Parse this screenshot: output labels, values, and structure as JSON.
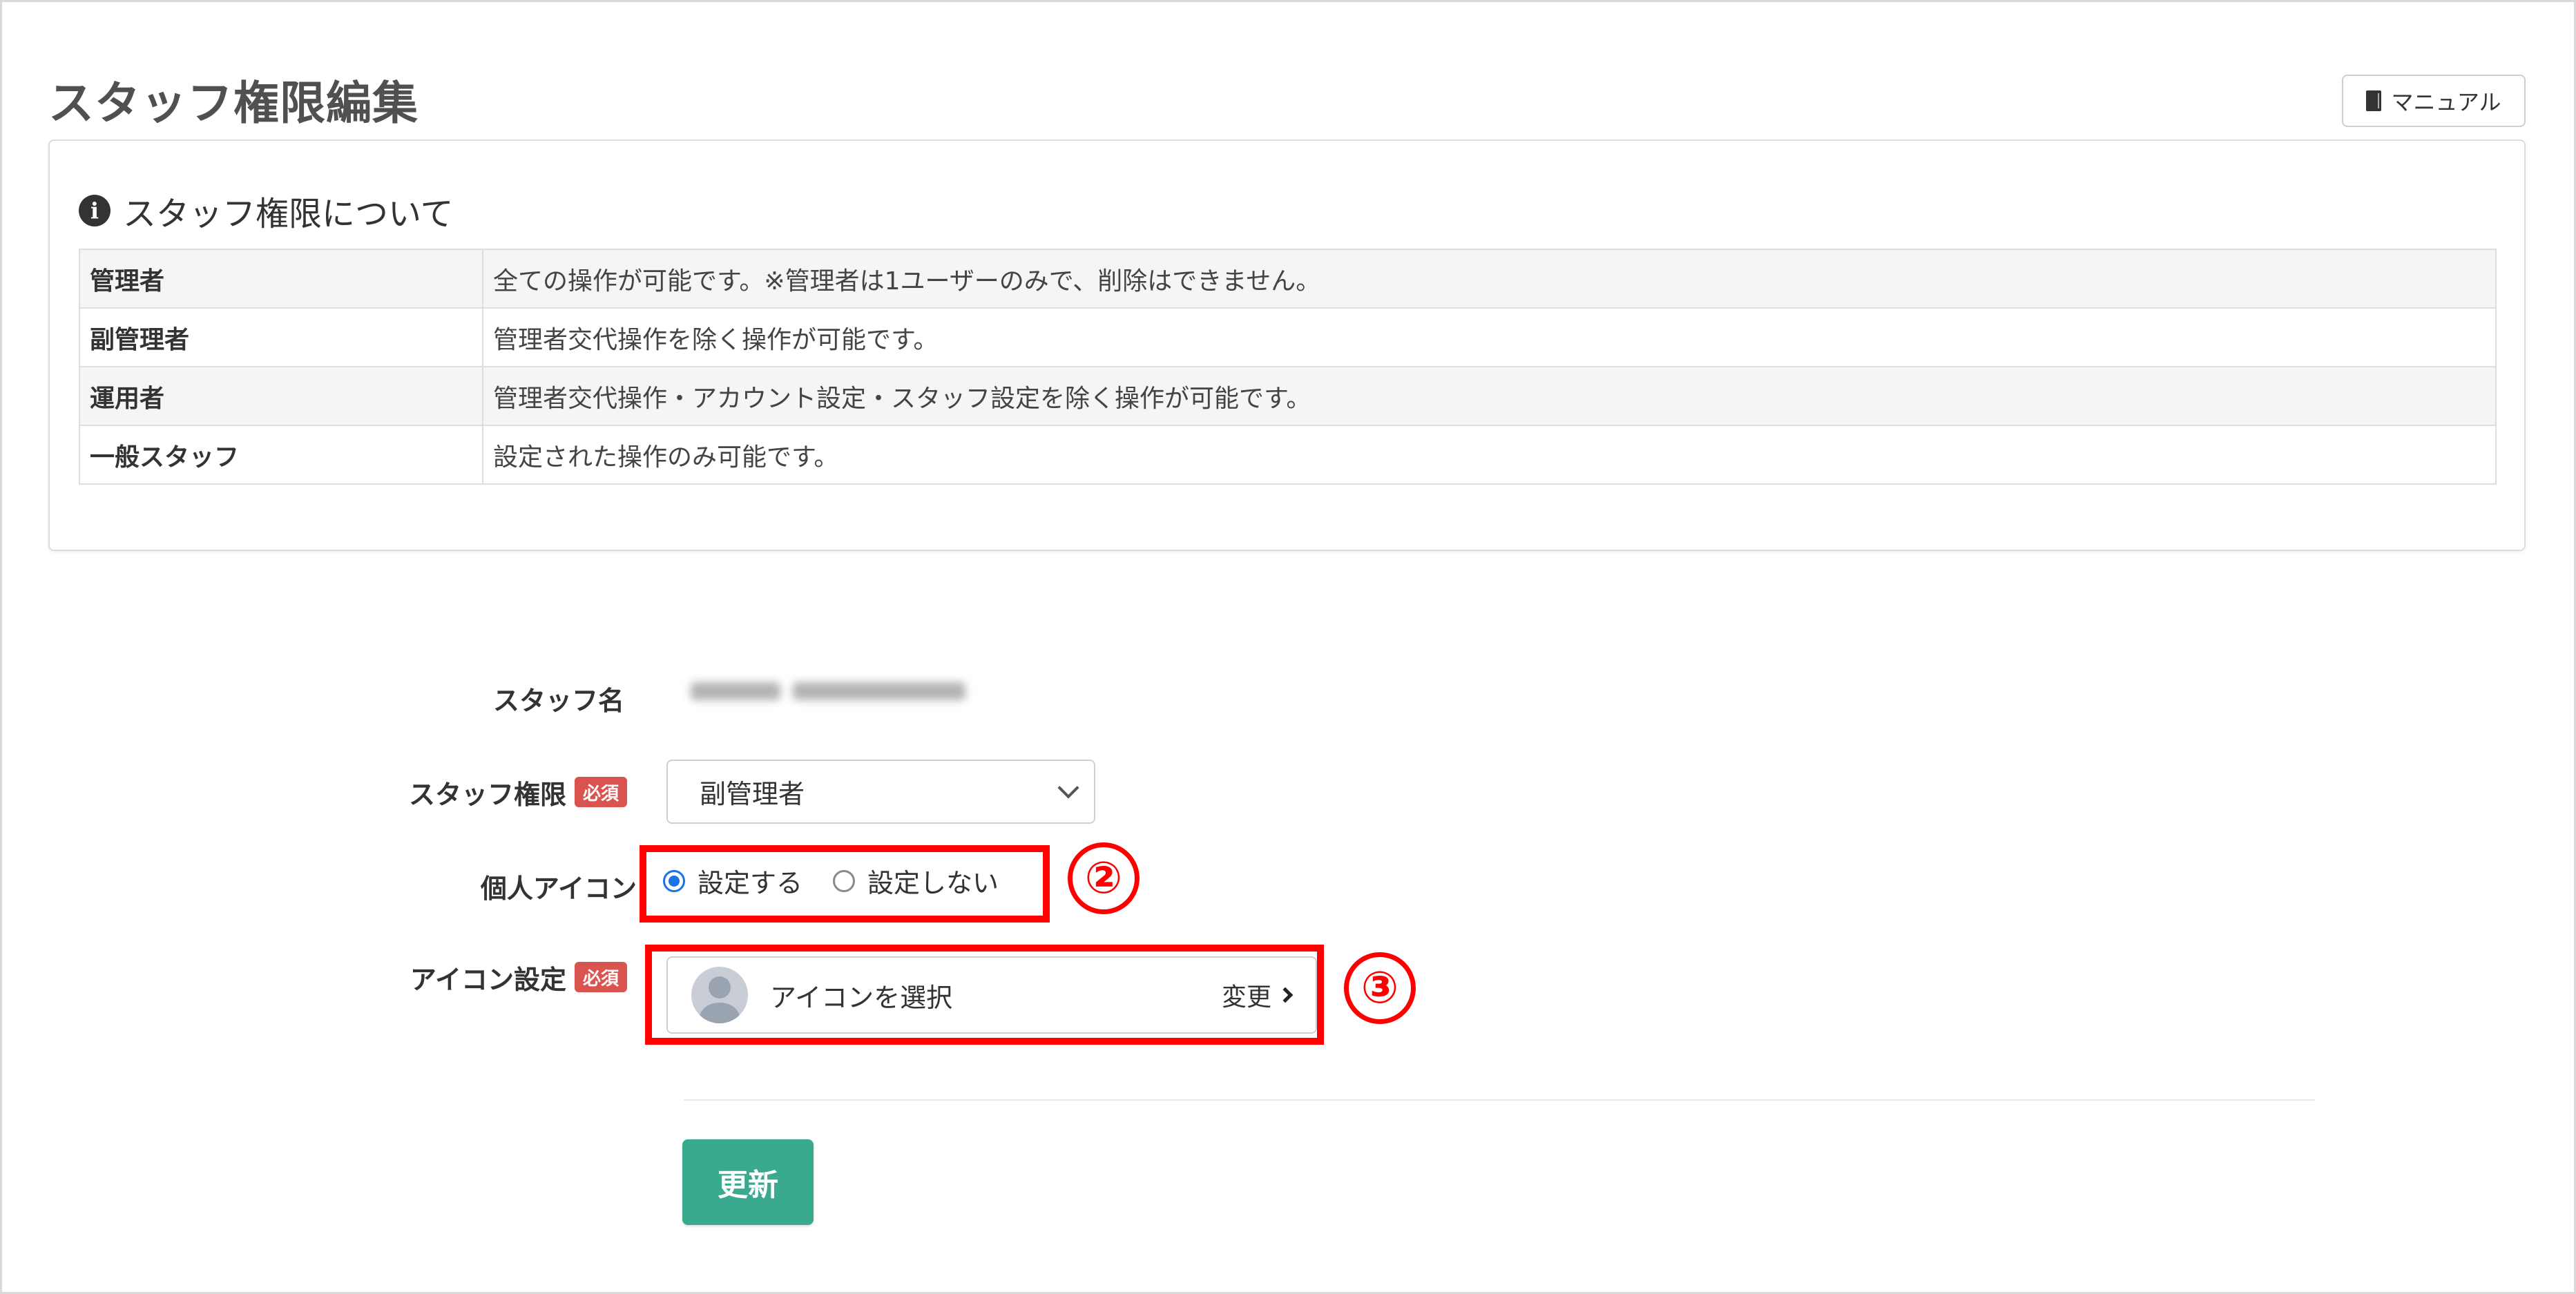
{
  "header": {
    "title": "スタッフ権限編集",
    "manual_label": "マニュアル"
  },
  "info": {
    "heading": "スタッフ権限について",
    "rows": [
      {
        "role": "管理者",
        "desc": "全ての操作が可能です。※管理者は1ユーザーのみで、削除はできません。"
      },
      {
        "role": "副管理者",
        "desc": "管理者交代操作を除く操作が可能です。"
      },
      {
        "role": "運用者",
        "desc": "管理者交代操作・アカウント設定・スタッフ設定を除く操作が可能です。"
      },
      {
        "role": "一般スタッフ",
        "desc": "設定された操作のみ可能です。"
      }
    ]
  },
  "form": {
    "staff_name_label": "スタッフ名",
    "permission_label": "スタッフ権限",
    "required_badge": "必須",
    "permission_value": "副管理者",
    "personal_icon_label": "個人アイコン",
    "radio_set": "設定する",
    "radio_unset": "設定しない",
    "radio_selected": "設定する",
    "icon_setting_label": "アイコン設定",
    "icon_select_text": "アイコンを選択",
    "change_label": "変更",
    "submit_label": "更新"
  },
  "annotations": {
    "marker_2": "②",
    "marker_3": "③",
    "highlight_color": "#ff0000"
  },
  "colors": {
    "primary_button": "#3aaa8e",
    "required_badge": "#d9534f",
    "radio_checked": "#1a73e8"
  },
  "icons": [
    "book-icon",
    "info-circle-icon",
    "chevron-down-icon",
    "user-avatar-icon",
    "chevron-right-icon"
  ]
}
